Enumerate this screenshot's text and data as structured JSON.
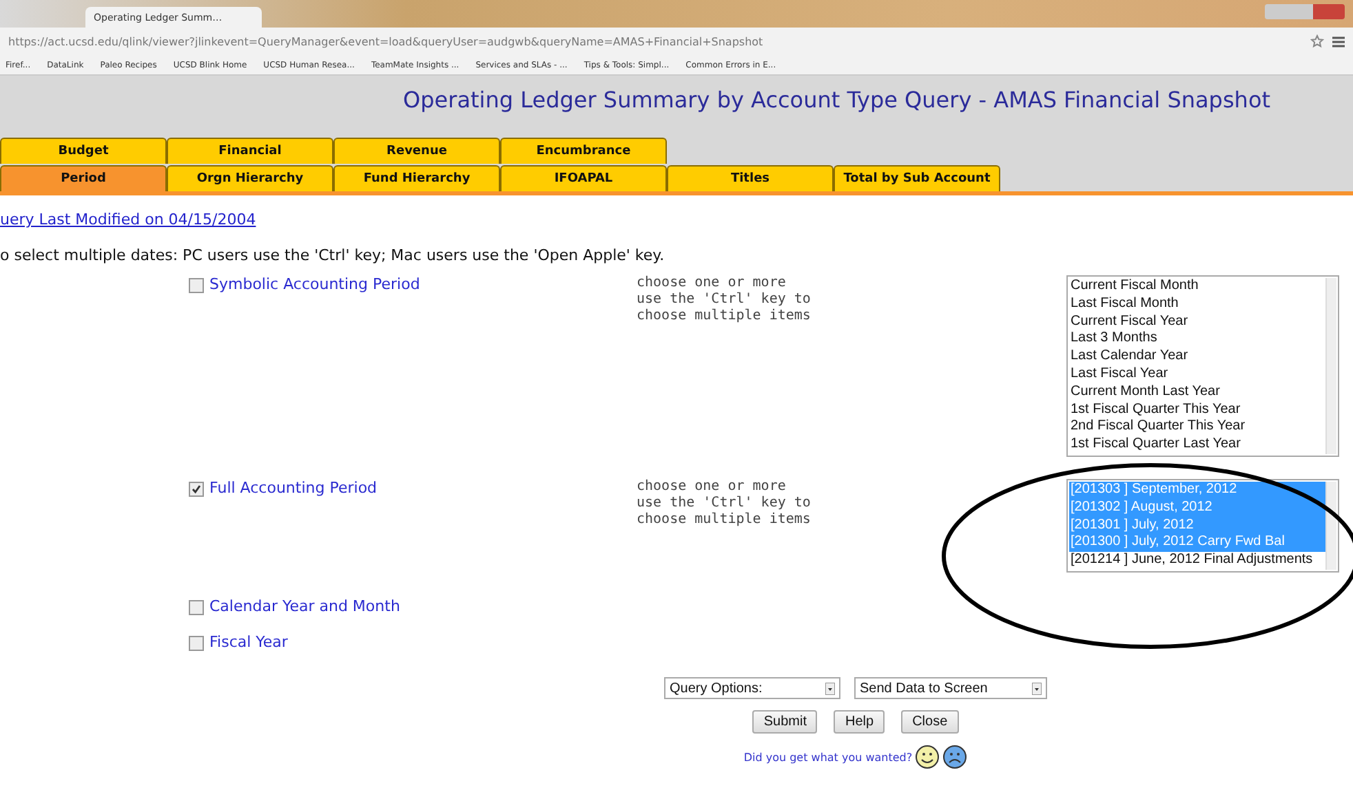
{
  "browser": {
    "tabs": [
      {
        "label": "Operating Ledger Summ…",
        "selected": true
      }
    ],
    "address": "https://act.ucsd.edu/qlink/viewer?jlinkevent=QueryManager&event=load&queryUser=audgwb&queryName=AMAS+Financial+Snapshot",
    "bookmarks": [
      "Firef...",
      "DataLink",
      "Paleo Recipes",
      "UCSD Blink Home",
      "UCSD Human Resea...",
      "TeamMate Insights ...",
      "Services and SLAs - ...",
      "Tips & Tools: Simpl...",
      "Common Errors in E..."
    ]
  },
  "page_title": "Operating Ledger Summary by Account Type Query - AMAS Financial Snapshot",
  "tab_rows": [
    [
      {
        "label": "Budget",
        "selected": false
      },
      {
        "label": "Financial",
        "selected": false
      },
      {
        "label": "Revenue",
        "selected": false
      },
      {
        "label": "Encumbrance",
        "selected": false
      }
    ],
    [
      {
        "label": "Period",
        "selected": true
      },
      {
        "label": "Orgn Hierarchy",
        "selected": false
      },
      {
        "label": "Fund Hierarchy",
        "selected": false
      },
      {
        "label": "IFOAPAL",
        "selected": false
      },
      {
        "label": "Titles",
        "selected": false
      },
      {
        "label": "Total by Sub Account",
        "selected": false
      }
    ]
  ],
  "modified_link": "uery Last Modified on 04/15/2004",
  "instructions": "o select multiple dates: PC users use the 'Ctrl' key; Mac users use the 'Open Apple' key.",
  "period_options": [
    {
      "label": "Symbolic Accounting Period",
      "checked": false,
      "hint": [
        "choose one or more",
        "use the 'Ctrl' key to",
        "choose multiple items"
      ],
      "list": [
        {
          "text": "Current Fiscal Month",
          "selected": false
        },
        {
          "text": "Last Fiscal Month",
          "selected": false
        },
        {
          "text": "Current Fiscal Year",
          "selected": false
        },
        {
          "text": "Last 3 Months",
          "selected": false
        },
        {
          "text": "Last Calendar Year",
          "selected": false
        },
        {
          "text": "Last Fiscal Year",
          "selected": false
        },
        {
          "text": "Current Month Last Year",
          "selected": false
        },
        {
          "text": "1st Fiscal Quarter This Year",
          "selected": false
        },
        {
          "text": "2nd Fiscal Quarter This Year",
          "selected": false
        },
        {
          "text": "1st Fiscal Quarter Last Year",
          "selected": false
        }
      ]
    },
    {
      "label": "Full Accounting Period",
      "checked": true,
      "hint": [
        "choose one or more",
        "use the 'Ctrl' key to",
        "choose multiple items"
      ],
      "list": [
        {
          "text": "[201303 ] September, 2012",
          "selected": true
        },
        {
          "text": "[201302 ] August, 2012",
          "selected": true
        },
        {
          "text": "[201301 ] July, 2012",
          "selected": true
        },
        {
          "text": "[201300 ] July, 2012 Carry Fwd Bal",
          "selected": true
        },
        {
          "text": "[201214 ] June, 2012 Final Adjustments",
          "selected": false
        }
      ]
    },
    {
      "label": "Calendar Year and Month",
      "checked": false
    },
    {
      "label": "Fiscal Year",
      "checked": false
    }
  ],
  "selects": [
    "Query Options:",
    "Send Data to Screen"
  ],
  "buttons": [
    "Submit",
    "Help",
    "Close"
  ],
  "feedback": "Did you get what you wanted?"
}
